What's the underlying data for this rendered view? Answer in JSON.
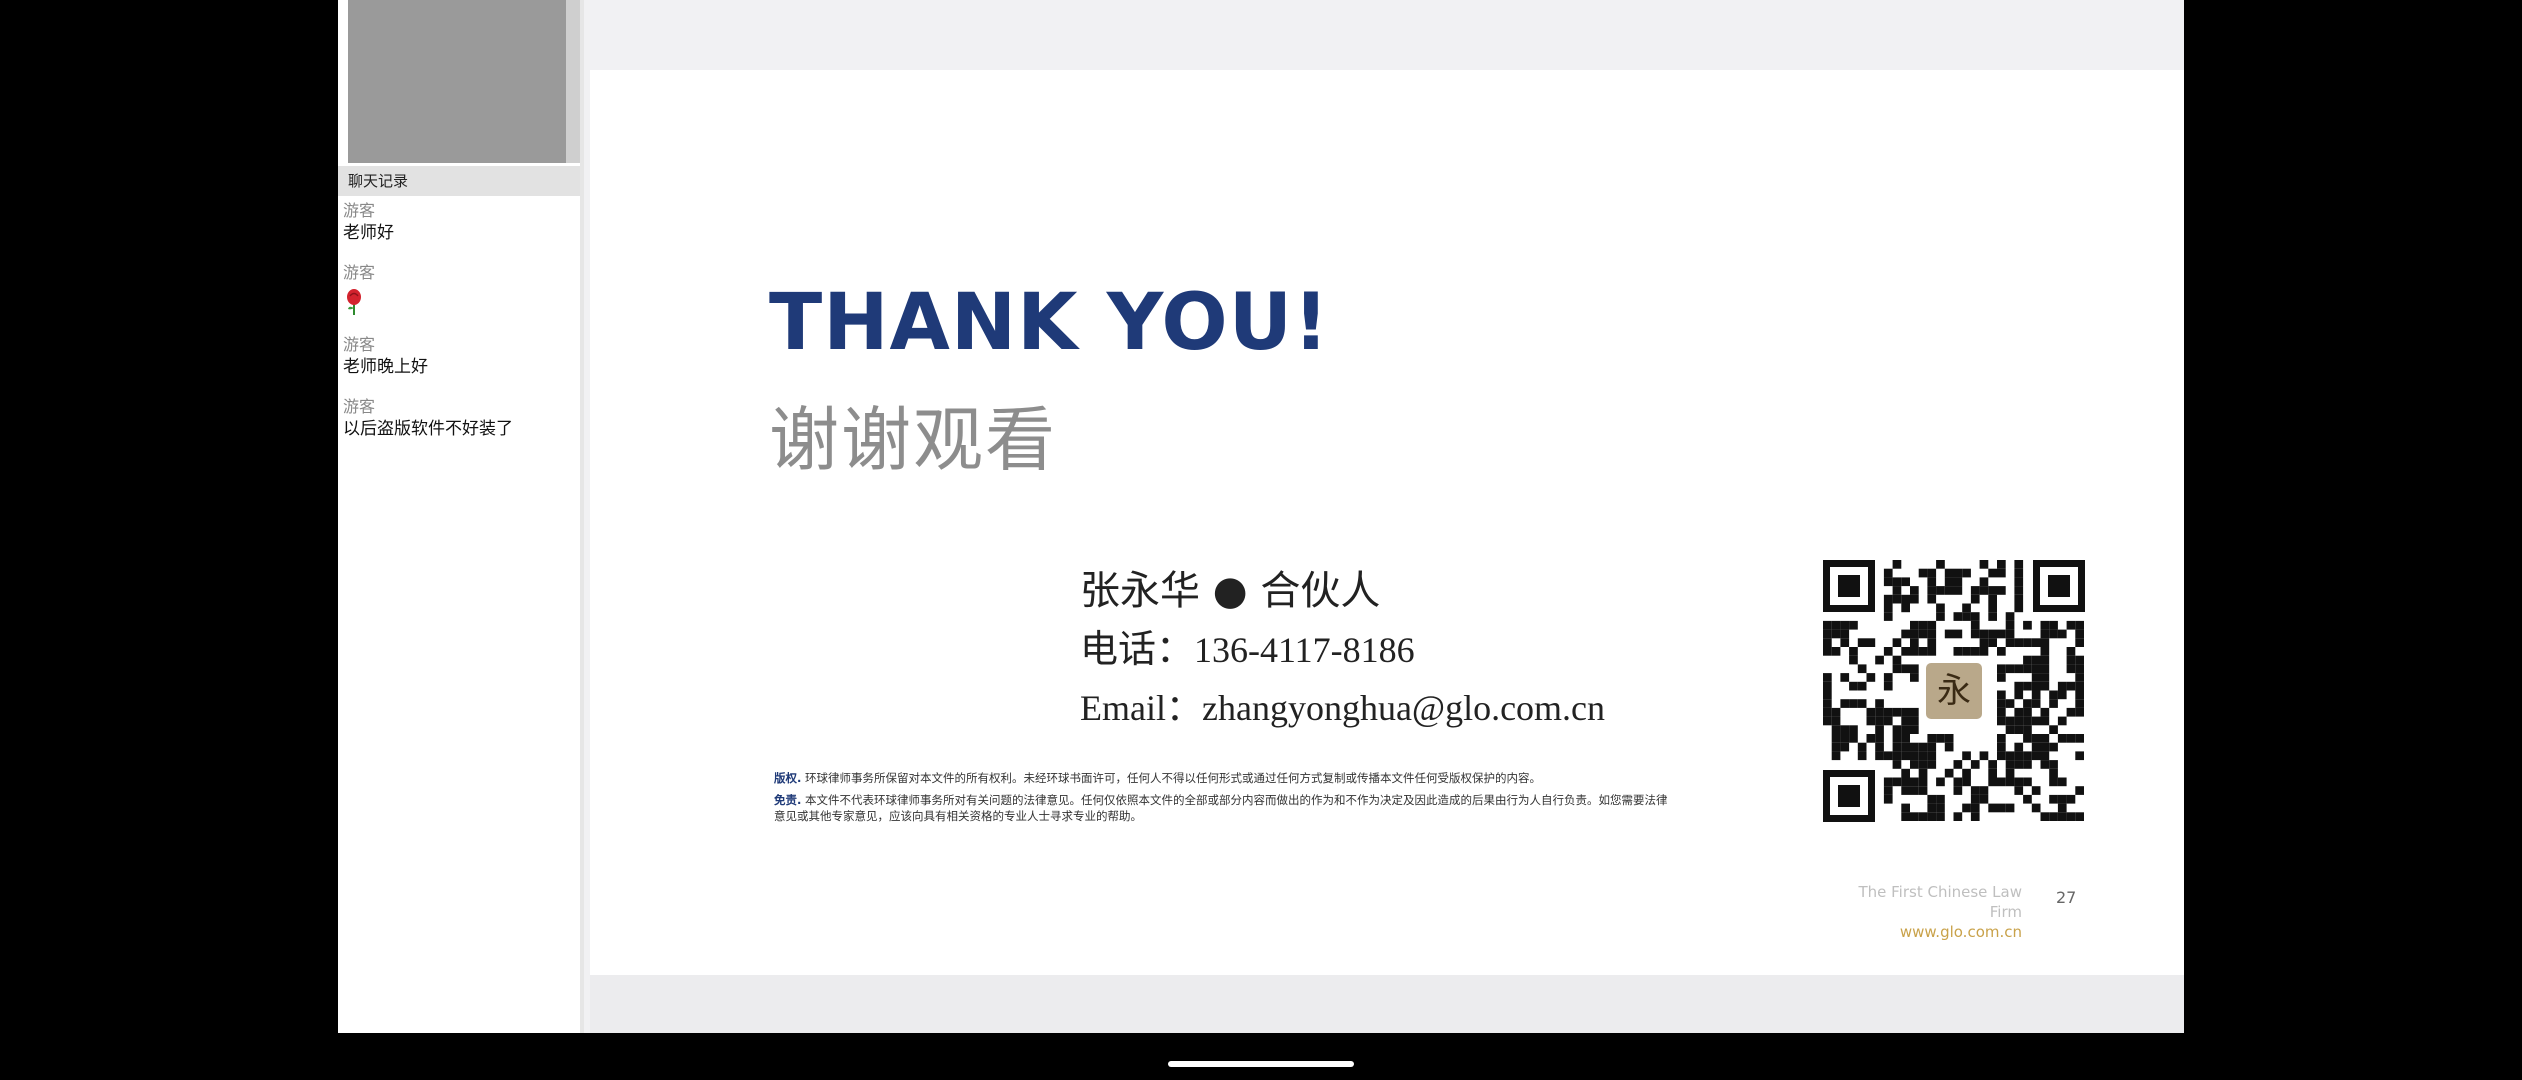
{
  "chat": {
    "header": "聊天记录",
    "messages": [
      {
        "sender": "游客",
        "text": "老师好"
      },
      {
        "sender": "游客",
        "icon": "rose-emoji"
      },
      {
        "sender": "游客",
        "text": "老师晚上好"
      },
      {
        "sender": "游客",
        "text": "以后盗版软件不好装了"
      }
    ]
  },
  "slide": {
    "title_en": "THANK YOU!",
    "title_cn": "谢谢观看",
    "contact": {
      "name_line": "张永华 ● 合伙人",
      "phone_label": "电话：",
      "phone": "136-4117-8186",
      "email_label": "Email：",
      "email": "zhangyonghua@glo.com.cn"
    },
    "notice": {
      "copyright_kw": "版权.",
      "copyright_text": "环球律师事务所保留对本文件的所有权利。未经环球书面许可，任何人不得以任何形式或通过任何方式复制或传播本文件任何受版权保护的内容。",
      "disclaimer_kw": "免责.",
      "disclaimer_text": "本文件不代表环球律师事务所对有关问题的法律意见。任何仅依照本文件的全部或部分内容而做出的作为和不作为决定及因此造成的后果由行为人自行负责。如您需要法律意见或其他专家意见，应该向具有相关资格的专业人士寻求专业的帮助。"
    },
    "qr_center_char": "永",
    "footer_firm": "The First Chinese Law Firm",
    "footer_web": "www.glo.com.cn",
    "page_number": "27"
  },
  "colors": {
    "title_blue": "#1f3a78",
    "title_gray": "#8d8d8d",
    "footer_gold": "#c9a24a"
  }
}
